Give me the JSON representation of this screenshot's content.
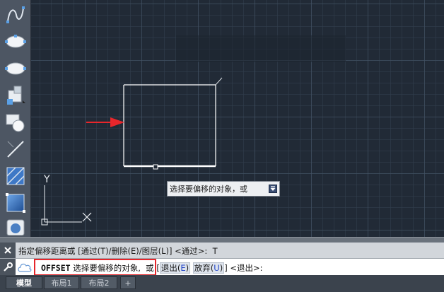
{
  "toolbar": {
    "tools": [
      "spline-icon",
      "ellipse-icon",
      "ellipse-arc-icon",
      "insert-block-icon",
      "create-block-icon",
      "line-diagonal-icon",
      "hatch-icon",
      "gradient-icon",
      "region-icon"
    ]
  },
  "canvas": {
    "ucs_y_label": "Y",
    "colors": {
      "background": "#212a36",
      "geometry": "#ffffff",
      "arrow": "#e8262b"
    }
  },
  "tooltip": {
    "text": "选择要偏移的对象，或"
  },
  "command": {
    "history": "指定偏移距离或 [通过(T)/删除(E)/图层(L)] <通过>:  T",
    "prompt_cmd": "OFFSET",
    "prompt_text": "选择要偏移的对象,",
    "or": "或",
    "opt1_label": "退出(",
    "opt1_key": "E",
    "opt1_end": ")",
    "opt2_label": "放弃(",
    "opt2_key": "U",
    "opt2_end": ")",
    "default": "<退出>:"
  },
  "tabs": {
    "model": "模型",
    "layout1": "布局1",
    "layout2": "布局2",
    "add": "+"
  }
}
